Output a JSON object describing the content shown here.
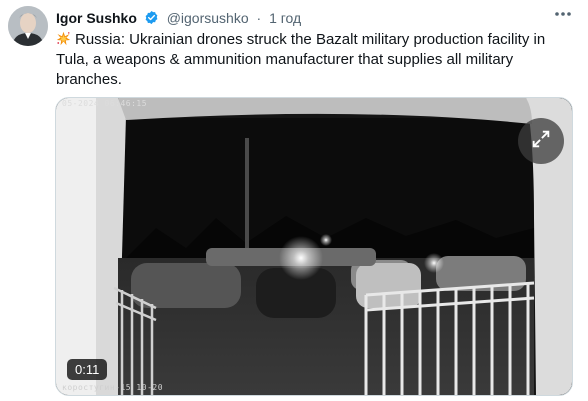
{
  "tweet": {
    "author_name": "Igor Sushko",
    "handle": "@igorsushko",
    "separator": "·",
    "time": "1 год",
    "text": "Russia: Ukrainian drones struck the Bazalt military production facility in Tula, a weapons & ammunition manufacturer that supplies all military branches.",
    "verified_color": "#1d9bf0"
  },
  "media": {
    "stamp_top": "05-2024 06:46:15",
    "stamp_bottom": "коростугин-15 10-20",
    "duration": "0:11"
  },
  "icons": {
    "avatar": "avatar",
    "verified": "verified-badge-icon",
    "explosion": "collision-emoji-icon",
    "more": "more-options-icon",
    "expand": "expand-icon"
  }
}
